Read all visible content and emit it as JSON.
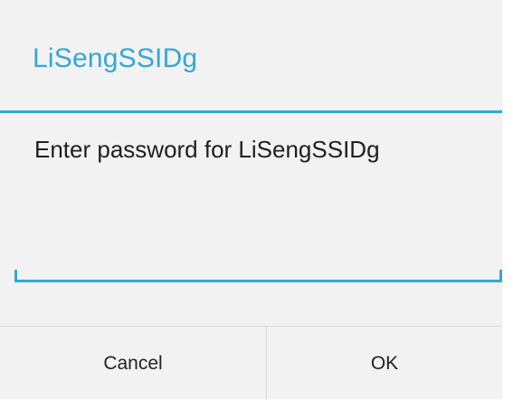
{
  "dialog": {
    "title": "LiSengSSIDg",
    "message": "Enter password for LiSengSSIDg",
    "password_value": "",
    "buttons": {
      "cancel_label": "Cancel",
      "ok_label": "OK"
    }
  },
  "colors": {
    "accent": "#35a7d6",
    "background": "#f2f2f2",
    "text": "#202020"
  }
}
